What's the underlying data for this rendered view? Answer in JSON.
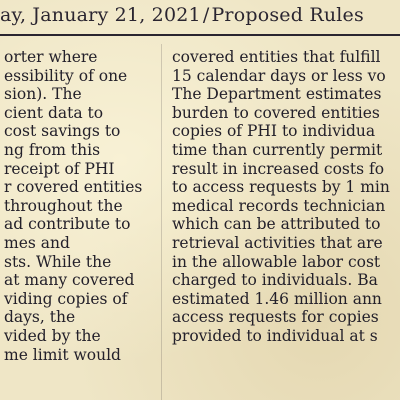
{
  "header": {
    "date_text": "ay, January 21, 2021",
    "separator": "/",
    "section_text": "Proposed Rules"
  },
  "columns": {
    "left": [
      "orter where",
      "essibility of one",
      "sion). The",
      "cient data to",
      "cost savings to",
      "ng from this",
      "receipt of PHI",
      "r covered entities",
      "throughout the",
      "ad contribute to",
      "mes and",
      "sts. While the",
      "at many covered",
      "viding copies of",
      "days, the",
      "vided by the",
      "me limit would"
    ],
    "right": [
      "covered entities that fulfill",
      "15 calendar days or less vo",
      "The Department estimates",
      "burden to covered entities",
      "copies of PHI to individua",
      "time than currently permit",
      "result in increased costs fo",
      "to access requests by 1 min",
      "medical records technician",
      "which can be attributed to",
      "retrieval activities that are",
      "in the allowable labor cost",
      "charged to individuals. Ba",
      "estimated 1.46 million ann",
      "access requests for copies",
      "provided to individual at s"
    ]
  },
  "colors": {
    "paper": "#efe6c6",
    "ink": "#23202a"
  }
}
